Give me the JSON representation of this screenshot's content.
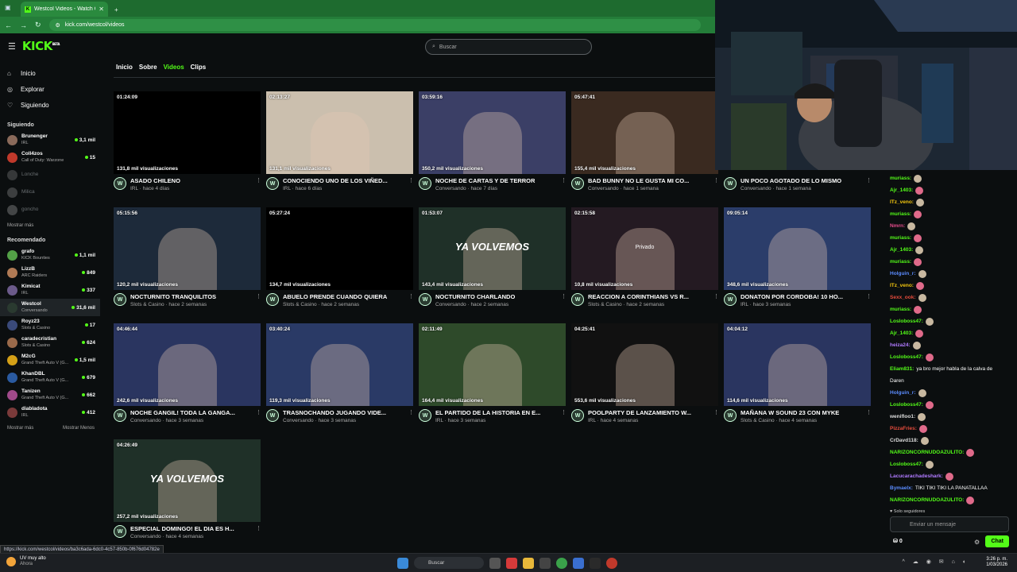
{
  "browser": {
    "tab_title": "Westcol Videos - Watch On-De",
    "url": "kick.com/westcol/videos",
    "status_url": "https://kick.com/westcol/videos/ba3c6ada-6dc0-4c57-850b-0f676d04782e"
  },
  "header": {
    "logo": "KICK",
    "logo_beta": "BETA",
    "search_placeholder": "Buscar"
  },
  "sidebar": {
    "nav": [
      {
        "label": "Inicio",
        "icon": "home-icon"
      },
      {
        "label": "Explorar",
        "icon": "compass-icon"
      },
      {
        "label": "Siguiendo",
        "icon": "heart-icon"
      }
    ],
    "following_title": "Siguiendo",
    "following": [
      {
        "name": "Brunenger",
        "cat": "IRL",
        "viewers": "3,1 mil",
        "live": true,
        "color": "#8a6a5a"
      },
      {
        "name": "Coll4zos",
        "cat": "Call of Duty: Warzone",
        "viewers": "15",
        "live": true,
        "color": "#c0392b"
      },
      {
        "name": "Lonche",
        "cat": "",
        "viewers": "",
        "live": false,
        "color": "#777"
      },
      {
        "name": "Milica",
        "cat": "",
        "viewers": "",
        "live": false,
        "color": "#888"
      },
      {
        "name": "goncho",
        "cat": "",
        "viewers": "",
        "live": false,
        "color": "#999"
      }
    ],
    "show_more": "Mostrar más",
    "recommended_title": "Recomendado",
    "recommended": [
      {
        "name": "grafo",
        "cat": "KICK Bounties",
        "viewers": "1,1 mil",
        "color": "#53a047"
      },
      {
        "name": "LizzB",
        "cat": "ARC Raiders",
        "viewers": "849",
        "color": "#b07a55"
      },
      {
        "name": "Kimicat",
        "cat": "IRL",
        "viewers": "337",
        "color": "#6b5a8a"
      },
      {
        "name": "Westcol",
        "cat": "Conversando",
        "viewers": "31,6 mil",
        "color": "#2a3a30",
        "selected": true
      },
      {
        "name": "Royz23",
        "cat": "Slots & Casino",
        "viewers": "17",
        "color": "#3a4a7a"
      },
      {
        "name": "caradecristian",
        "cat": "Slots & Casino",
        "viewers": "624",
        "color": "#9a6a4a"
      },
      {
        "name": "M2cG",
        "cat": "Grand Theft Auto V (G...",
        "viewers": "1,5 mil",
        "color": "#d4a017"
      },
      {
        "name": "KhanDBL",
        "cat": "Grand Theft Auto V (G...",
        "viewers": "679",
        "color": "#2a5aa0"
      },
      {
        "name": "Tanizen",
        "cat": "Grand Theft Auto V (G...",
        "viewers": "662",
        "color": "#a04a8a"
      },
      {
        "name": "diabladota",
        "cat": "IRL",
        "viewers": "412",
        "color": "#7a3a3a"
      }
    ],
    "show_more2": "Mostrar más",
    "show_less": "Mostrar Menos"
  },
  "channel_tabs": [
    "Inicio",
    "Sobre",
    "Videos",
    "Clips"
  ],
  "videos": [
    {
      "dur": "01:24:09",
      "views": "131,8 mil visualizaciones",
      "title": "ASADO CHILENO",
      "meta": "IRL · hace 4 días",
      "bg": "#000",
      "overlay": ""
    },
    {
      "dur": "02:13:27",
      "views": "131,1 mil visualizaciones",
      "title": "CONOCIENDO UNO DE LOS VIÑED...",
      "meta": "IRL · hace 6 días",
      "bg": "#cbbfae",
      "overlay": ""
    },
    {
      "dur": "03:59:16",
      "views": "350,2 mil visualizaciones",
      "title": "NOCHE DE CARTAS Y DE TERROR",
      "meta": "Conversando · hace 7 días",
      "bg": "#3b3f66",
      "overlay": ""
    },
    {
      "dur": "05:47:41",
      "views": "155,4 mil visualizaciones",
      "title": "BAD BUNNY NO LE GUSTA MI CO...",
      "meta": "Conversando · hace 1 semana",
      "bg": "#3a2a20",
      "overlay": ""
    },
    {
      "dur": "",
      "views": "",
      "title": "UN POCO AGOTADO DE LO MISMO",
      "meta": "Conversando · hace 1 semana",
      "bg": "none",
      "overlay": ""
    },
    {
      "dur": "05:15:56",
      "views": "120,2 mil visualizaciones",
      "title": "NOCTURNITO TRANQUILITOS",
      "meta": "Slots & Casino · hace 2 semanas",
      "bg": "#1d2a3a",
      "overlay": ""
    },
    {
      "dur": "05:27:24",
      "views": "134,7 mil visualizaciones",
      "title": "ABUELO PRENDE CUANDO QUIERA",
      "meta": "Slots & Casino · hace 2 semanas",
      "bg": "#000",
      "overlay": ""
    },
    {
      "dur": "01:53:07",
      "views": "143,4 mil visualizaciones",
      "title": "NOCTURNITO CHARLANDO",
      "meta": "Conversando · hace 2 semanas",
      "bg": "#1f3028",
      "overlay": "YA VOLVEMOS"
    },
    {
      "dur": "02:15:58",
      "views": "10,8 mil visualizaciones",
      "title": "REACCION A CORINTHIANS VS R...",
      "meta": "Slots & Casino · hace 2 semanas",
      "bg": "#241a22",
      "overlay": "Privado"
    },
    {
      "dur": "09:05:14",
      "views": "348,6 mil visualizaciones",
      "title": "DONATON POR CORDOBA! 10 HO...",
      "meta": "IRL · hace 3 semanas",
      "bg": "#2b3d6a",
      "overlay": ""
    },
    {
      "dur": "04:46:44",
      "views": "242,6 mil visualizaciones",
      "title": "NOCHE GANGIL! TODA LA GANGA...",
      "meta": "Conversando · hace 3 semanas",
      "bg": "#2a3560",
      "overlay": ""
    },
    {
      "dur": "03:40:24",
      "views": "119,3 mil visualizaciones",
      "title": "TRASNOCHANDO JUGANDO VIDE...",
      "meta": "Conversando · hace 3 semanas",
      "bg": "#2a3a66",
      "overlay": ""
    },
    {
      "dur": "02:11:49",
      "views": "164,4 mil visualizaciones",
      "title": "EL PARTIDO DE LA HISTORIA EN E...",
      "meta": "IRL · hace 3 semanas",
      "bg": "#2e4a2a",
      "overlay": ""
    },
    {
      "dur": "04:25:41",
      "views": "553,6 mil visualizaciones",
      "title": "POOLPARTY DE LANZAMIENTO W...",
      "meta": "IRL · hace 4 semanas",
      "bg": "#111",
      "overlay": ""
    },
    {
      "dur": "04:04:12",
      "views": "114,6 mil visualizaciones",
      "title": "MAÑANA W SOUND 23 CON MYKE",
      "meta": "Slots & Casino · hace 4 semanas",
      "bg": "#2a3560",
      "overlay": ""
    },
    {
      "dur": "04:26:49",
      "views": "257,2 mil visualizaciones",
      "title": "ESPECIAL DOMINGO! EL DIA ES H...",
      "meta": "Conversando · hace 4 semanas",
      "bg": "#1f3028",
      "overlay": "YA VOLVEMOS"
    }
  ],
  "chat": {
    "messages": [
      {
        "user": "muriass:",
        "text": "",
        "color": "#53fc18"
      },
      {
        "user": "Ajr_1403:",
        "text": "",
        "color": "#53fc18"
      },
      {
        "user": "ITz_veno:",
        "text": "",
        "color": "#f1c40f"
      },
      {
        "user": "muriass:",
        "text": "",
        "color": "#53fc18"
      },
      {
        "user": "Nmrn:",
        "text": "",
        "color": "#e74c8c"
      },
      {
        "user": "muriass:",
        "text": "",
        "color": "#53fc18"
      },
      {
        "user": "Ajr_1403:",
        "text": "",
        "color": "#53fc18"
      },
      {
        "user": "muriass:",
        "text": "",
        "color": "#53fc18"
      },
      {
        "user": "Holguin_r:",
        "text": "",
        "color": "#5b8cff"
      },
      {
        "user": "ITz_veno:",
        "text": "",
        "color": "#f1c40f"
      },
      {
        "user": "Sexx_ook:",
        "text": "",
        "color": "#e74c3c"
      },
      {
        "user": "muriass:",
        "text": "",
        "color": "#53fc18"
      },
      {
        "user": "Losloboss47:",
        "text": "",
        "color": "#53fc18"
      },
      {
        "user": "Ajr_1403:",
        "text": "",
        "color": "#53fc18"
      },
      {
        "user": "heiza24:",
        "text": "",
        "color": "#b07aff"
      },
      {
        "user": "Losloboss47:",
        "text": "",
        "color": "#53fc18"
      },
      {
        "user": "Eliam831:",
        "text": "ya bro mejor habla de la calva de",
        "color": "#53fc18"
      },
      {
        "user": "",
        "text": "Daren",
        "color": "#fff"
      },
      {
        "user": "Holguin_r:",
        "text": "",
        "color": "#5b8cff"
      },
      {
        "user": "Losloboss47:",
        "text": "",
        "color": "#53fc18"
      },
      {
        "user": "wenifloo1:",
        "text": "",
        "color": "#ddd"
      },
      {
        "user": "PizzaFries:",
        "text": "",
        "color": "#e74c3c"
      },
      {
        "user": "CrDavd118:",
        "text": "",
        "color": "#ddd"
      },
      {
        "user": "NARIZONCORNUDOAZULITO:",
        "text": "",
        "color": "#53fc18"
      },
      {
        "user": "Losloboss47:",
        "text": "",
        "color": "#53fc18"
      },
      {
        "user": "Lacucarachadeshark:",
        "text": "",
        "color": "#b07aff"
      },
      {
        "user": "Bymaelx:",
        "text": "TIKI TIKI TIKI LA PANATALLAA",
        "color": "#5b8cff"
      },
      {
        "user": "NARIZONCORNUDOAZULITO:",
        "text": "",
        "color": "#53fc18"
      }
    ],
    "followers_only": "Solo seguidores",
    "placeholder": "Enviar un mensaje",
    "points": "0",
    "send": "Chat"
  },
  "taskbar": {
    "weather_title": "UV muy alto",
    "weather_sub": "Ahora",
    "search": "Buscar",
    "time": "3:26 p. m.",
    "date": "1/03/2026"
  }
}
